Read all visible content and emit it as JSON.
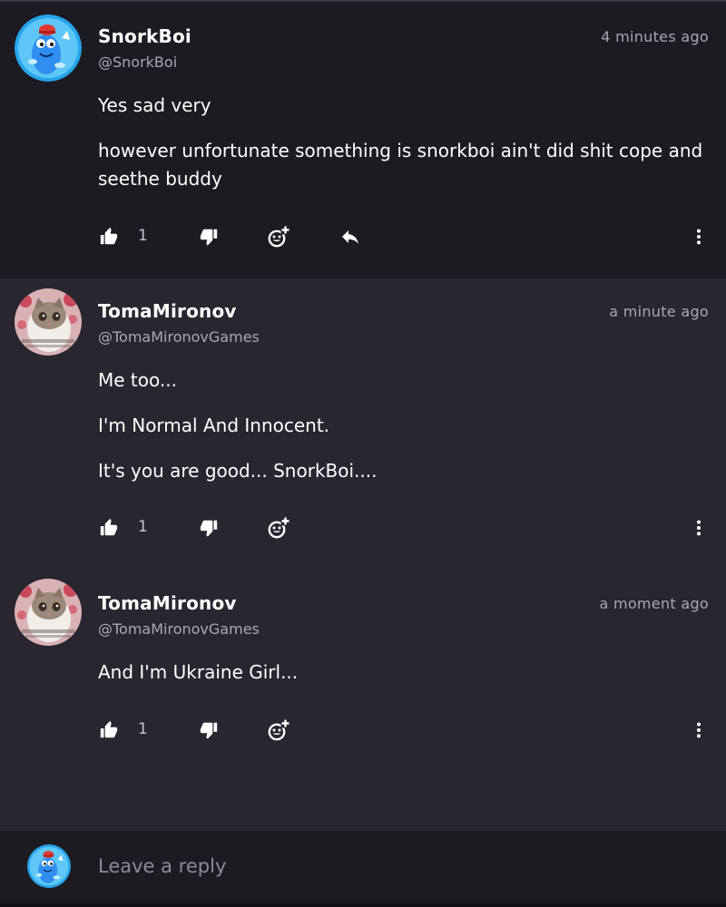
{
  "comments": [
    {
      "author": "SnorkBoi",
      "handle": "@SnorkBoi",
      "time": "4 minutes ago",
      "avatar": "blue-cartoon-creature-avatar",
      "paragraphs": [
        "Yes sad very",
        "however unfortunate something is snorkboi ain't did shit cope and seethe buddy"
      ],
      "likes": "1",
      "has_reply_button": true
    },
    {
      "author": "TomaMironov",
      "handle": "@TomaMironovGames",
      "time": "a minute ago",
      "avatar": "cat-photo-avatar",
      "paragraphs": [
        "Me too...",
        "I'm Normal And Innocent.",
        "It's you are good... SnorkBoi...."
      ],
      "likes": "1",
      "has_reply_button": false
    },
    {
      "author": "TomaMironov",
      "handle": "@TomaMironovGames",
      "time": "a moment ago",
      "avatar": "cat-photo-avatar",
      "paragraphs": [
        "And I'm Ukraine Girl..."
      ],
      "likes": "1",
      "has_reply_button": false
    }
  ],
  "reply_box": {
    "placeholder": "Leave a reply",
    "avatar": "blue-cartoon-creature-avatar"
  },
  "icons": {
    "like": "thumbs-up-icon",
    "dislike": "thumbs-down-icon",
    "reaction": "add-emoji-icon",
    "reply": "reply-arrow-icon",
    "more": "more-vertical-icon"
  },
  "colors": {
    "page_background": "#28262f",
    "highlighted_comment_background": "#1c1b22",
    "text_primary": "#ffffff",
    "text_secondary": "#a9a7b1",
    "avatar_blue": "#2aa3ee"
  }
}
